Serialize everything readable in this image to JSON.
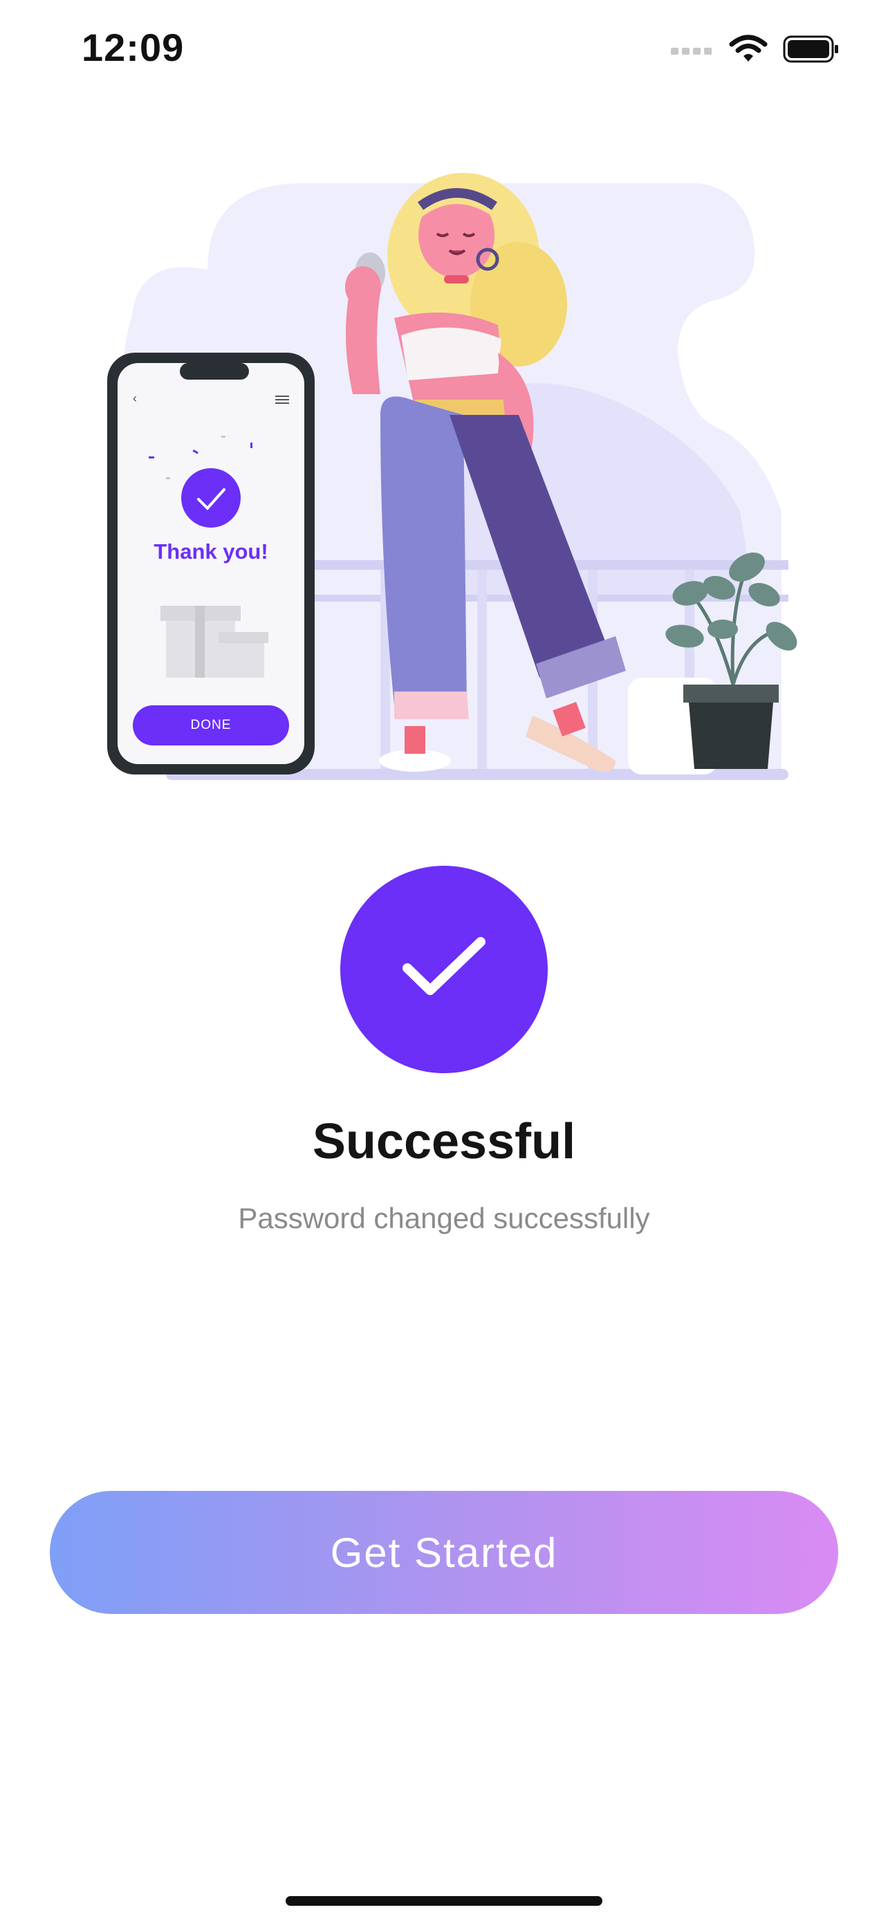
{
  "status_bar": {
    "time": "12:09",
    "icons": [
      "cellular-signal-icon",
      "wifi-icon",
      "battery-icon"
    ]
  },
  "illustration": {
    "phone_message": "Thank you!",
    "phone_button": "DONE",
    "icon_names": [
      "woman-holding-phone-illustration",
      "potted-plant-icon",
      "gift-boxes-icon",
      "back-chevron-icon",
      "hamburger-menu-icon"
    ]
  },
  "main": {
    "title": "Successful",
    "subtitle": "Password changed successfully",
    "check_icon": "checkmark-icon"
  },
  "cta": {
    "label": "Get Started"
  },
  "colors": {
    "accent": "#6B2FF8",
    "gradient_start": "#7F9FF6",
    "gradient_end": "#D98BF3",
    "title_text": "#141414",
    "subtitle_text": "#8A8A8A"
  }
}
